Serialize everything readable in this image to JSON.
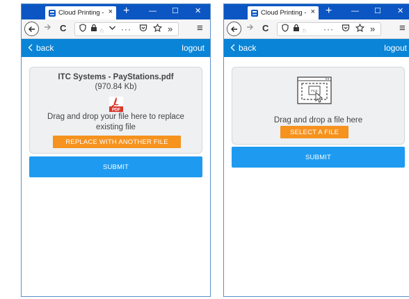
{
  "browser": {
    "tab_title": "Cloud Printing - \\",
    "tab_close": "×",
    "new_tab": "+",
    "minimize": "—",
    "maximize": "☐",
    "close": "✕",
    "reload": "C",
    "more": "···",
    "overflow": "»",
    "menu": "≡",
    "url_faded": "h"
  },
  "app": {
    "back_label": "back",
    "logout_label": "logout",
    "submit_label": "SUBMIT"
  },
  "left": {
    "file_name": "ITC Systems - PayStations.pdf",
    "file_size": "(970.84 Kb)",
    "pdf_badge": "PDF",
    "drop_text": "Drag and drop your file here to replace existing file",
    "replace_label": "REPLACE WITH ANOTHER FILE"
  },
  "right": {
    "drop_text": "Drag and drop a file here",
    "select_label": "SELECT A FILE",
    "illus_file_label": "FILE"
  },
  "colors": {
    "tabstrip": "#0b56c2",
    "appbar": "#0a84d6",
    "submit": "#1e9bf0",
    "orange": "#f6921e",
    "pdf_red": "#d9362b"
  }
}
